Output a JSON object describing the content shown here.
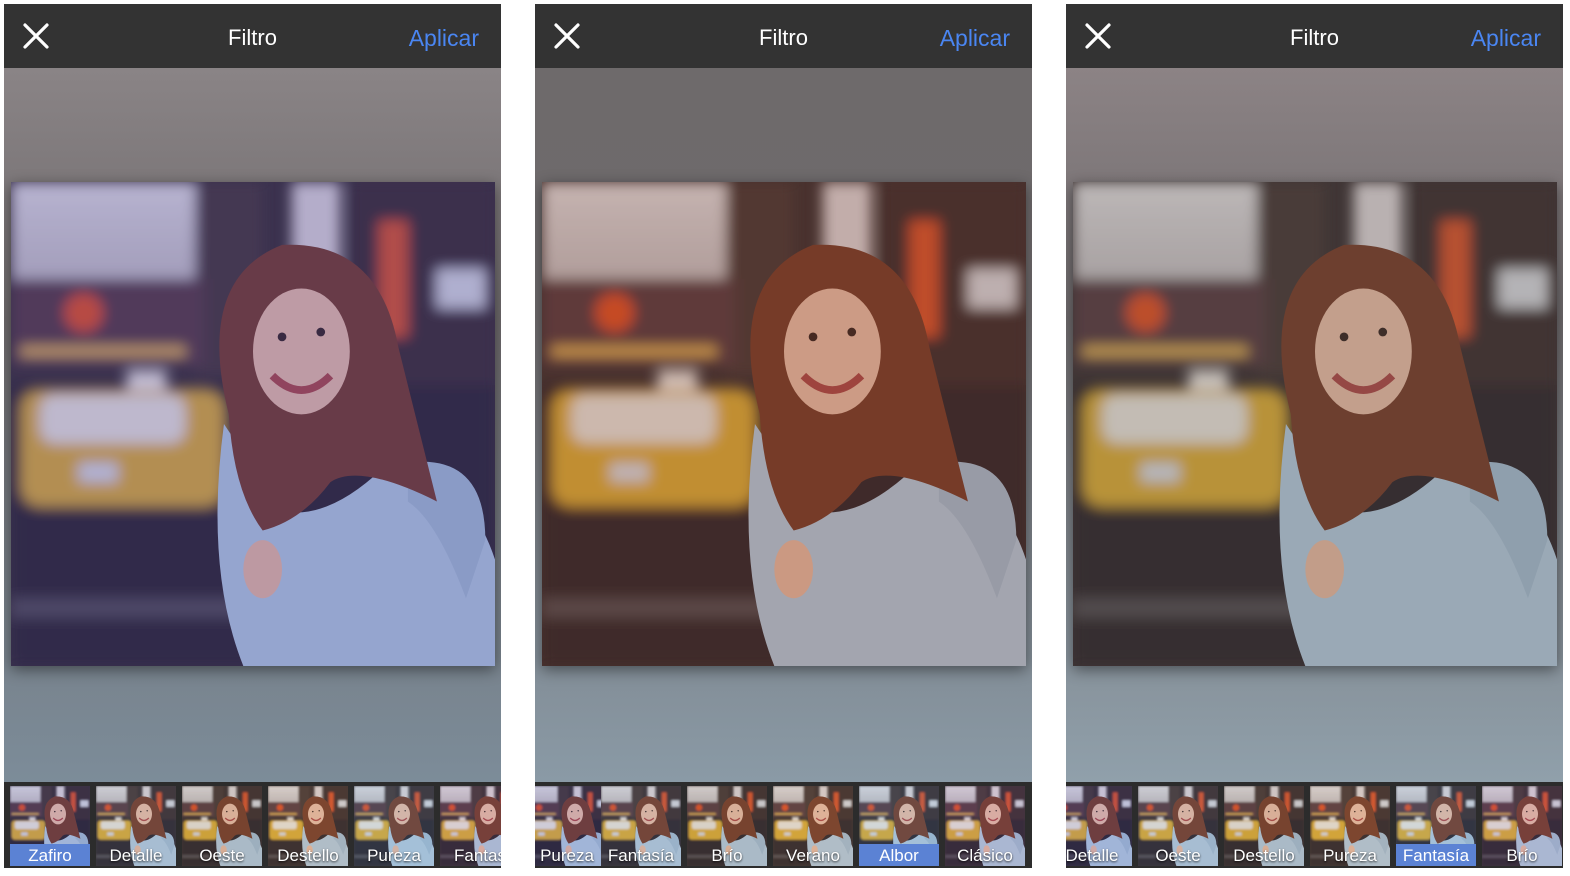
{
  "screens": [
    {
      "header": {
        "title": "Filtro",
        "apply_label": "Aplicar",
        "close_icon": "close-icon"
      },
      "photo_tint": "#3a2a8a",
      "bg_top": "#8a8486",
      "bg_bottom": "#7c8c99",
      "filters": [
        {
          "label": "Zafiro",
          "selected": true
        },
        {
          "label": "Detalle",
          "selected": false
        },
        {
          "label": "Oeste",
          "selected": false
        },
        {
          "label": "Destello",
          "selected": false
        },
        {
          "label": "Pureza",
          "selected": false
        },
        {
          "label": "Fantas",
          "selected": false
        }
      ]
    },
    {
      "header": {
        "title": "Filtro",
        "apply_label": "Aplicar",
        "close_icon": "close-icon"
      },
      "photo_tint": "#6a2c14",
      "bg_top": "#6e6a6b",
      "bg_bottom": "#8a9aa6",
      "filters": [
        {
          "label": "Pureza",
          "selected": false
        },
        {
          "label": "Fantasía",
          "selected": false
        },
        {
          "label": "Brío",
          "selected": false
        },
        {
          "label": "Verano",
          "selected": false
        },
        {
          "label": "Albor",
          "selected": true
        },
        {
          "label": "Clásico",
          "selected": false
        }
      ]
    },
    {
      "header": {
        "title": "Filtro",
        "apply_label": "Aplicar",
        "close_icon": "close-icon"
      },
      "photo_tint": "#4a3a30",
      "bg_top": "#8c8385",
      "bg_bottom": "#90a0ab",
      "filters": [
        {
          "label": "Detalle",
          "selected": false
        },
        {
          "label": "Oeste",
          "selected": false
        },
        {
          "label": "Destello",
          "selected": false
        },
        {
          "label": "Pureza",
          "selected": false
        },
        {
          "label": "Fantasía",
          "selected": true
        },
        {
          "label": "Brío",
          "selected": false
        }
      ]
    }
  ]
}
